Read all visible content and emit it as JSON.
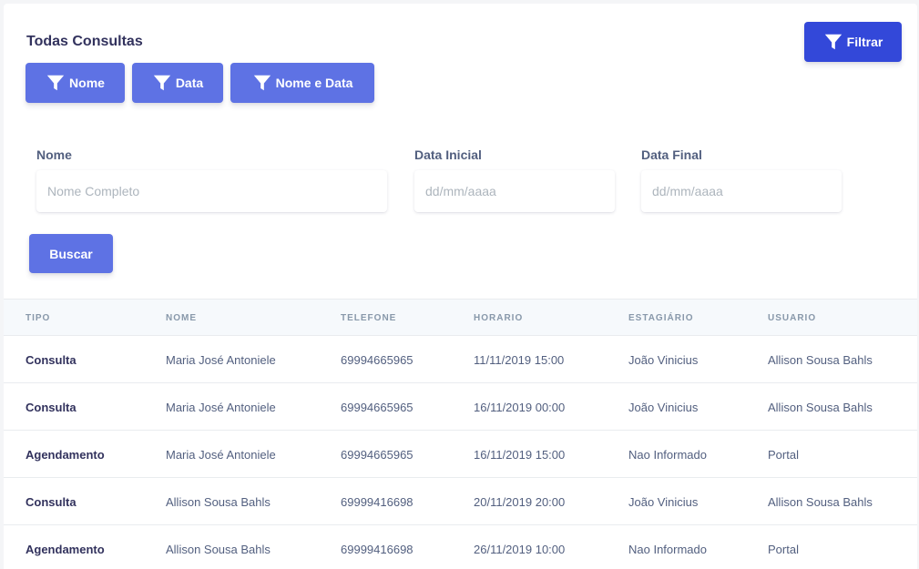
{
  "header": {
    "title": "Todas Consultas",
    "filtrar_label": "Filtrar"
  },
  "filters": {
    "nome_label": "Nome",
    "data_label": "Data",
    "nome_data_label": "Nome e Data"
  },
  "form": {
    "nome_label": "Nome",
    "nome_placeholder": "Nome Completo",
    "data_inicial_label": "Data Inicial",
    "data_inicial_placeholder": "dd/mm/aaaa",
    "data_final_label": "Data Final",
    "data_final_placeholder": "dd/mm/aaaa",
    "buscar_label": "Buscar"
  },
  "table": {
    "columns": [
      "Tipo",
      "Nome",
      "Telefone",
      "Horario",
      "Estagiário",
      "Usuario"
    ],
    "rows": [
      [
        "Consulta",
        "Maria José Antoniele",
        "69994665965",
        "11/11/2019 15:00",
        "João Vinicius",
        "Allison Sousa Bahls"
      ],
      [
        "Consulta",
        "Maria José Antoniele",
        "69994665965",
        "16/11/2019 00:00",
        "João Vinicius",
        "Allison Sousa Bahls"
      ],
      [
        "Agendamento",
        "Maria José Antoniele",
        "69994665965",
        "16/11/2019 15:00",
        "Nao Informado",
        "Portal"
      ],
      [
        "Consulta",
        "Allison Sousa Bahls",
        "69999416698",
        "20/11/2019 20:00",
        "João Vinicius",
        "Allison Sousa Bahls"
      ],
      [
        "Agendamento",
        "Allison Sousa Bahls",
        "69999416698",
        "26/11/2019 10:00",
        "Nao Informado",
        "Portal"
      ]
    ]
  },
  "icons": {
    "filter": "filter-icon"
  },
  "colors": {
    "primary": "#5e72e4",
    "primary_dark": "#3348d9"
  }
}
